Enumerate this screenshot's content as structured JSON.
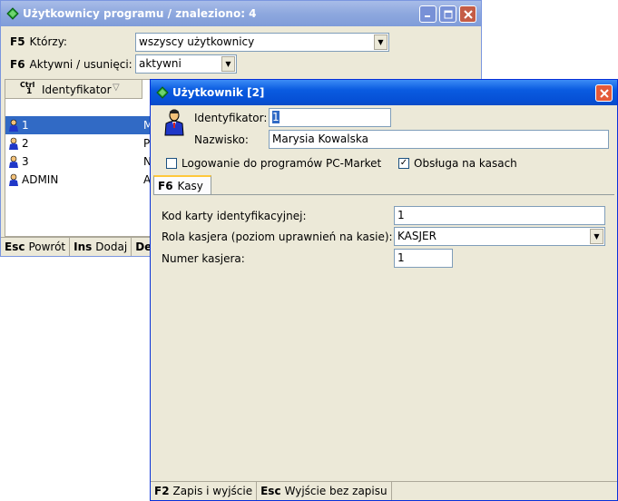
{
  "list_window": {
    "title": "Użytkownicy programu / znaleziono: 4",
    "filter1": {
      "key": "F5",
      "label": "Którzy:",
      "value": "wszyscy użytkownicy"
    },
    "filter2": {
      "key": "F6",
      "label": "Aktywni / usunięci:",
      "value": "aktywni"
    },
    "column": {
      "key_top": "Ctrl",
      "key_bottom": "1",
      "label": "Identyfikator"
    },
    "rows": [
      {
        "id": "1",
        "col2": "M",
        "selected": true
      },
      {
        "id": "2",
        "col2": "P",
        "selected": false
      },
      {
        "id": "3",
        "col2": "N",
        "selected": false
      },
      {
        "id": "ADMIN",
        "col2": "A",
        "selected": false
      }
    ],
    "status": [
      {
        "key": "Esc",
        "label": "Powrót"
      },
      {
        "key": "Ins",
        "label": "Dodaj"
      },
      {
        "key": "De",
        "label": ""
      }
    ]
  },
  "dialog": {
    "title": "Użytkownik [2]",
    "identifier_label": "Identyfikator:",
    "identifier_value": "1",
    "surname_label": "Nazwisko:",
    "surname_value": "Marysia Kowalska",
    "login_checkbox_label": "Logowanie do programów PC-Market",
    "login_checked": false,
    "pos_checkbox_label": "Obsługa na kasach",
    "pos_checked": true,
    "tab": {
      "key": "F6",
      "label": "Kasy"
    },
    "card_label": "Kod karty identyfikacyjnej:",
    "card_value": "1",
    "role_label": "Rola kasjera (poziom uprawnień na kasie):",
    "role_value": "KASJER",
    "cashier_number_label": "Numer kasjera:",
    "cashier_number_value": "1",
    "status": [
      {
        "key": "F2",
        "label": "Zapis i wyjście"
      },
      {
        "key": "Esc",
        "label": "Wyjście bez zapisu"
      }
    ]
  },
  "colors": {
    "selection": "#316ac5",
    "title_active": "#0a5be0",
    "title_inactive": "#8ea8de"
  }
}
